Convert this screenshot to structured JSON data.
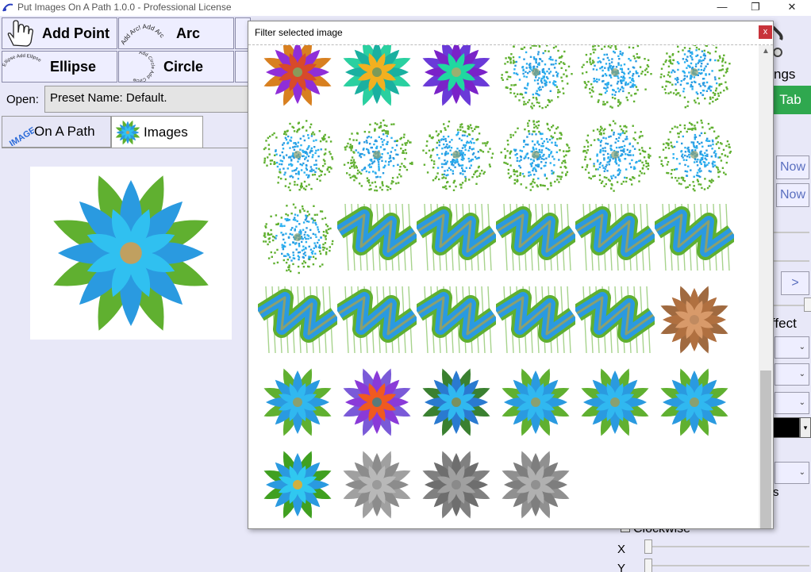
{
  "window": {
    "title": "Put Images On A Path 1.0.0 - Professional License",
    "minimize_glyph": "—",
    "restore_glyph": "❐",
    "close_glyph": "✕"
  },
  "toolbar": {
    "add_point_label": "Add Point",
    "arc_label": "Arc",
    "ellipse_label": "Ellipse",
    "circle_label": "Circle",
    "arc_icon_text": "Add Arc! Add Arc",
    "ellipse_icon_text": "Ellipse Add Ellipse",
    "circle_icon_text": "Add Circle Add Circle"
  },
  "open": {
    "label": "Open:",
    "preset_value": "Preset Name: Default."
  },
  "tabs": {
    "path_icon_text": "IMAGE",
    "path_label": "On A Path",
    "images_label": "Images"
  },
  "right_panel": {
    "ngs_fragment": "ngs",
    "tab_fragment": "Tab",
    "now_1": "Now",
    "now_2": "Now",
    "next": ">",
    "effect_fragment": "ffect",
    "s_fragment": "s",
    "clockwise_label": "Clockwise",
    "x_label": "X",
    "y_label": "Y",
    "combo_arrow": "⌄",
    "swatch_arrow": "▾"
  },
  "dialog": {
    "title": "Filter selected image",
    "close_glyph": "x",
    "scroll_up_glyph": "▲",
    "thumbnails": [
      {
        "kind": "flower",
        "petal": "#8f2ed8",
        "inner": "#d84a2a",
        "center": "#8a9a5a",
        "leaf": "#d88020"
      },
      {
        "kind": "flower",
        "petal": "#1ab0a0",
        "inner": "#f2b020",
        "center": "#7a9a5a",
        "leaf": "#2ad0a0"
      },
      {
        "kind": "flower",
        "petal": "#7a22c8",
        "inner": "#20d8a0",
        "center": "#9ab070",
        "leaf": "#6a3ad8"
      },
      {
        "kind": "speckle",
        "petal": "#2a9ae0",
        "inner": "#2ab0f0",
        "center": "#8aa070",
        "leaf": "#60b030"
      },
      {
        "kind": "speckle",
        "petal": "#2a9ae0",
        "inner": "#2ab0f0",
        "center": "#8aa070",
        "leaf": "#60b030"
      },
      {
        "kind": "speckle",
        "petal": "#2a9ae0",
        "inner": "#2ab0f0",
        "center": "#8aa070",
        "leaf": "#60b030"
      },
      {
        "kind": "speckle",
        "petal": "#2a9ae0",
        "inner": "#2ab0f0",
        "center": "#8aa070",
        "leaf": "#60b030"
      },
      {
        "kind": "speckle",
        "petal": "#2a9ae0",
        "inner": "#2ab0f0",
        "center": "#8aa070",
        "leaf": "#60b030"
      },
      {
        "kind": "speckle",
        "petal": "#2a9ae0",
        "inner": "#2ab0f0",
        "center": "#8aa070",
        "leaf": "#60b030"
      },
      {
        "kind": "speckle",
        "petal": "#2a9ae0",
        "inner": "#2ab0f0",
        "center": "#8aa070",
        "leaf": "#60b030"
      },
      {
        "kind": "speckle",
        "petal": "#2a9ae0",
        "inner": "#2ab0f0",
        "center": "#8aa070",
        "leaf": "#60b030"
      },
      {
        "kind": "speckle",
        "petal": "#2a9ae0",
        "inner": "#2ab0f0",
        "center": "#8aa070",
        "leaf": "#60b030"
      },
      {
        "kind": "speckle",
        "petal": "#2a9ae0",
        "inner": "#2ab0f0",
        "center": "#8aa070",
        "leaf": "#60b030"
      },
      {
        "kind": "wave",
        "petal": "#2a9ae0",
        "inner": "#2ab0f0",
        "center": "#8aa070",
        "leaf": "#60b030"
      },
      {
        "kind": "wave",
        "petal": "#2a9ae0",
        "inner": "#2ab0f0",
        "center": "#8aa070",
        "leaf": "#60b030"
      },
      {
        "kind": "wave",
        "petal": "#2a9ae0",
        "inner": "#2ab0f0",
        "center": "#8aa070",
        "leaf": "#60b030"
      },
      {
        "kind": "wave",
        "petal": "#2a9ae0",
        "inner": "#2ab0f0",
        "center": "#8aa070",
        "leaf": "#60b030"
      },
      {
        "kind": "wave",
        "petal": "#2a9ae0",
        "inner": "#2ab0f0",
        "center": "#8aa070",
        "leaf": "#60b030"
      },
      {
        "kind": "wave",
        "petal": "#2a9ae0",
        "inner": "#2ab0f0",
        "center": "#8aa070",
        "leaf": "#60b030"
      },
      {
        "kind": "wave",
        "petal": "#2a9ae0",
        "inner": "#2ab0f0",
        "center": "#8aa070",
        "leaf": "#60b030"
      },
      {
        "kind": "wave",
        "petal": "#2a9ae0",
        "inner": "#2ab0f0",
        "center": "#8aa070",
        "leaf": "#60b030"
      },
      {
        "kind": "wave",
        "petal": "#2a9ae0",
        "inner": "#2ab0f0",
        "center": "#8aa070",
        "leaf": "#60b030"
      },
      {
        "kind": "wave",
        "petal": "#2a9ae0",
        "inner": "#2ab0f0",
        "center": "#8aa070",
        "leaf": "#60b030"
      },
      {
        "kind": "flower",
        "petal": "#b07040",
        "inner": "#d89a6a",
        "center": "#c08a60",
        "leaf": "#a06a40"
      },
      {
        "kind": "flower",
        "petal": "#2a9ae0",
        "inner": "#30b8f0",
        "center": "#8aa070",
        "leaf": "#60b030"
      },
      {
        "kind": "flower",
        "petal": "#8a3ad8",
        "inner": "#f05a20",
        "center": "#5a7a7a",
        "leaf": "#7a5ad8"
      },
      {
        "kind": "flower",
        "petal": "#2a7ad0",
        "inner": "#30b8f0",
        "center": "#7a9060",
        "leaf": "#3a8030"
      },
      {
        "kind": "flower",
        "petal": "#2a9ae0",
        "inner": "#30b8f0",
        "center": "#8aa070",
        "leaf": "#60b030"
      },
      {
        "kind": "flower",
        "petal": "#2a9ae0",
        "inner": "#30b8f0",
        "center": "#8aa070",
        "leaf": "#60b030"
      },
      {
        "kind": "flower",
        "petal": "#2a9ae0",
        "inner": "#30b8f0",
        "center": "#8aa070",
        "leaf": "#60b030"
      },
      {
        "kind": "flower",
        "petal": "#2a9ae0",
        "inner": "#30c8f0",
        "center": "#d0b040",
        "leaf": "#40a020"
      },
      {
        "kind": "flower",
        "petal": "#8c8c8c",
        "inner": "#b8b8b8",
        "center": "#9a9a9a",
        "leaf": "#a0a0a0"
      },
      {
        "kind": "flower",
        "petal": "#6e6e6e",
        "inner": "#a0a0a0",
        "center": "#8a8a8a",
        "leaf": "#808080"
      },
      {
        "kind": "flower",
        "petal": "#7e7e7e",
        "inner": "#b0b0b0",
        "center": "#909090",
        "leaf": "#909090"
      }
    ]
  },
  "preview": {
    "petal": "#2a9ae0",
    "inner": "#30c0f0",
    "center": "#c0a060",
    "leaf": "#60b030"
  }
}
